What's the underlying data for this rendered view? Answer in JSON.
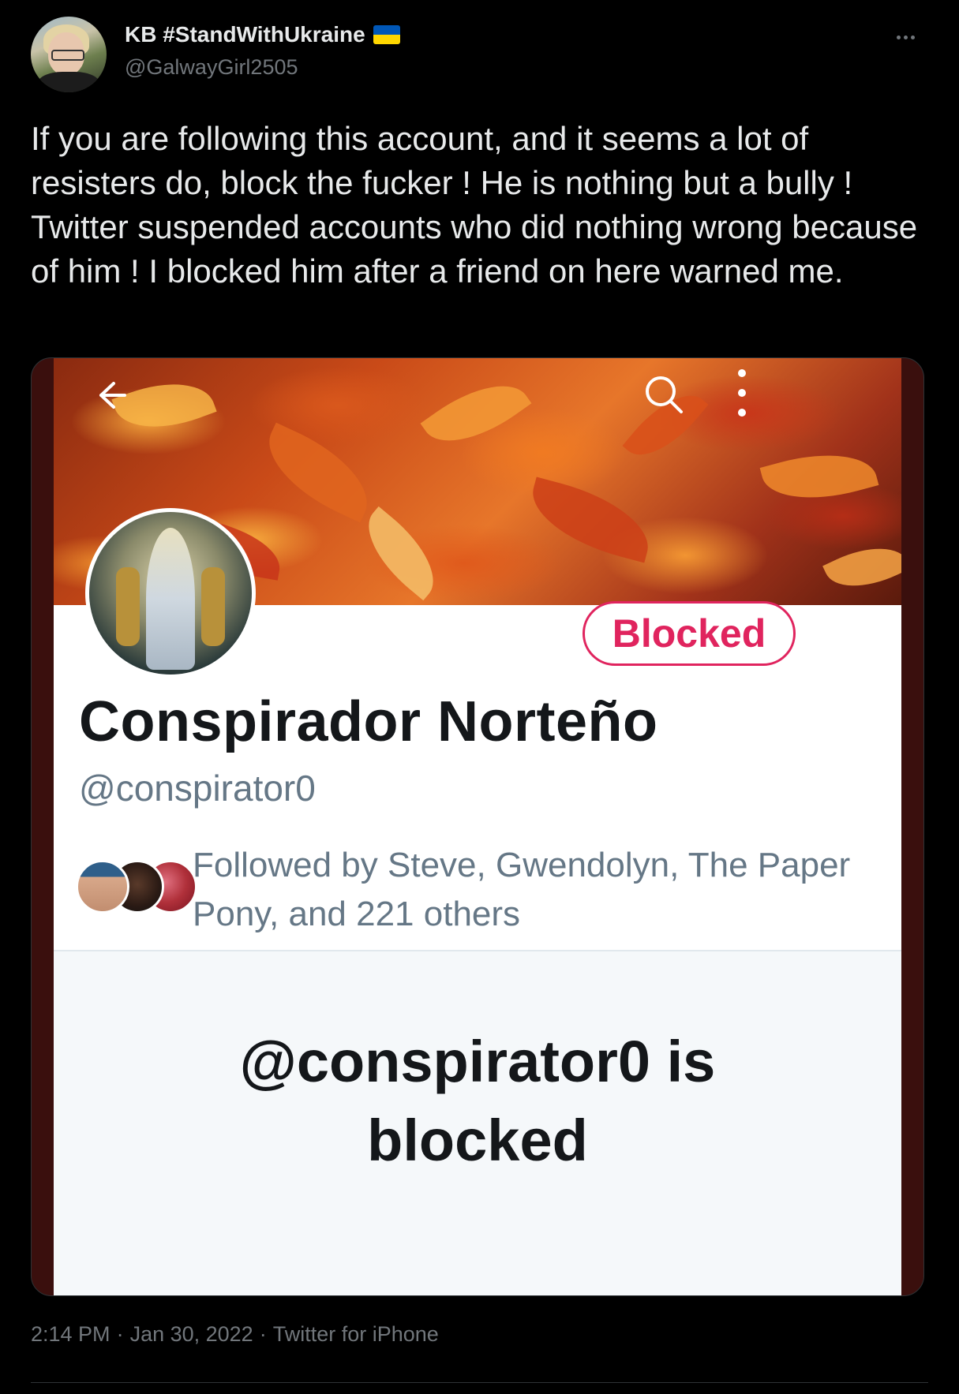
{
  "author": {
    "display_name": "KB #StandWithUkraine",
    "handle": "@GalwayGirl2505",
    "flag_colors": [
      "#0057b7",
      "#ffd700"
    ]
  },
  "tweet": {
    "text": "If you are following this account, and it seems a lot of resisters do, block the fucker ! He is nothing but a bully ! Twitter suspended accounts who did nothing wrong because of him ! I blocked him after a friend on here warned me."
  },
  "media": {
    "blocked_button_label": "Blocked",
    "profile_name": "Conspirador Norteño",
    "profile_handle": "@conspirator0",
    "followers_text": "Followed by Steve, Gwendolyn, The Paper Pony, and 221 others",
    "blocked_title_line1": "@conspirator0 is",
    "blocked_title_line2": "blocked",
    "accent_color": "#e0245e"
  },
  "meta": {
    "time": "2:14 PM",
    "separator": "·",
    "date": "Jan 30, 2022",
    "source": "Twitter for iPhone"
  }
}
